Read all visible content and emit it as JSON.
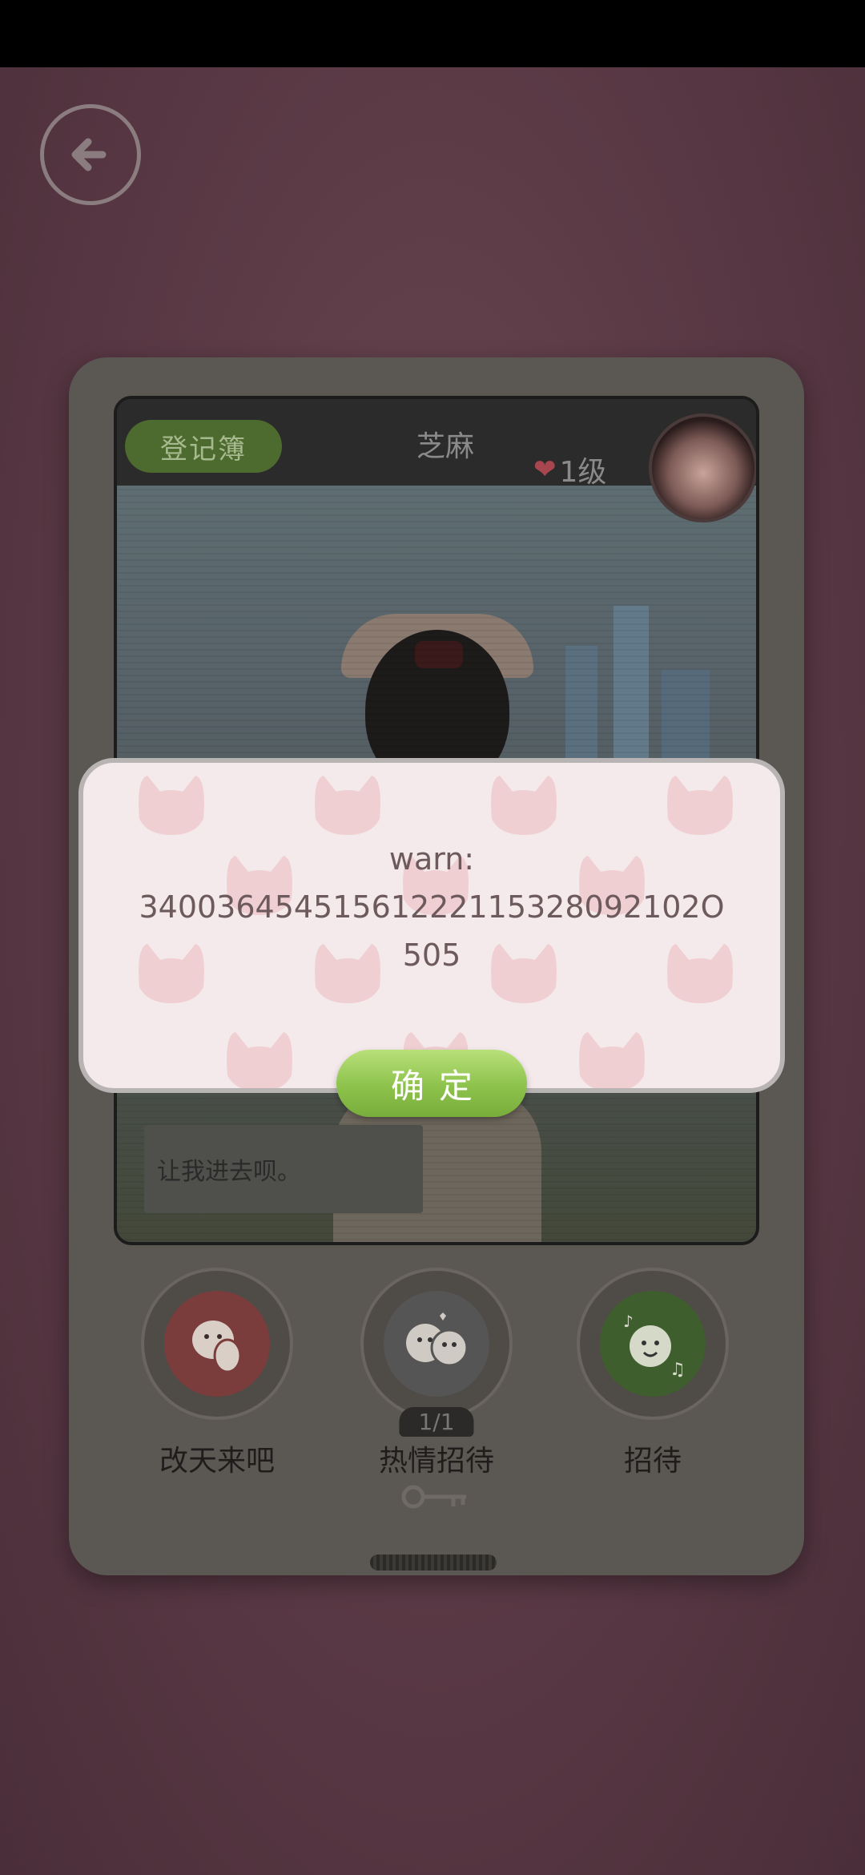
{
  "top_bar": {
    "register_label": "登记簿",
    "visitor_name": "芝麻",
    "level_text": "1级"
  },
  "scene": {
    "speech_text": "让我进去呗。"
  },
  "actions": [
    {
      "label": "改天来吧",
      "icon": "refuse-face-icon",
      "color": "#7a3d3b"
    },
    {
      "label": "热情招待",
      "icon": "chatting-faces-icon",
      "color": "#555555",
      "pager": "1/1"
    },
    {
      "label": "招待",
      "icon": "singing-face-icon",
      "color": "#3f5e2e"
    }
  ],
  "dialog": {
    "line1": "warn:",
    "line2": "34003645451561222115328092102O",
    "line3": "505",
    "confirm_label": "确定"
  },
  "colors": {
    "confirm_green": "#8dc24c",
    "register_green": "#4d6b2f",
    "heart_red": "#a84650"
  }
}
